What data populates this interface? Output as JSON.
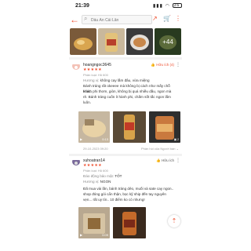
{
  "status": {
    "time": "21:39",
    "battery": "36"
  },
  "topbar": {
    "search_placeholder": "Dầu Ăn Cái Lân"
  },
  "gallery": {
    "more_count": "+44"
  },
  "reviews": [
    {
      "username": "hoangngoc3645",
      "helpful": "Hữu ích (4)",
      "stars": "★★★★★",
      "variant": "Phân loại: Hũ 600",
      "taste_label": "Hương vị:",
      "taste_value": "không cay lắm đâu, vừa miệng",
      "body": [
        "Bánh tráng rất okeeee mà không bị cách như mấy chỗ khác.",
        "Hành phi thơm, giòn, không bị quá nhiều dầu, ngon mà",
        "rẻ. Bánh tráng cuốn ít hành phi, chấm sốt tắc ngon lắm",
        "luôn."
      ],
      "video_time": "0:13",
      "date": "29-10-2023 09:20",
      "report": "Phản hồi của Người bán"
    },
    {
      "username": "xuhoatran14",
      "helpful": "Hữu ích",
      "stars": "★★★★★",
      "variant": "Phân loại: Hũ 600",
      "quality_label": "Đáo động bảo mật:",
      "quality_value": "TỐT",
      "taste_label": "Hương vị:",
      "taste_value": "NGON",
      "body": [
        "Đã mua vài lần, bánh tráng dẻo, muối và sate cay ngon..",
        "shop đóng gói cẩn thận, bọc kỹ ship đến tay nguyên",
        "vẹn... rất uy tín.. 10 điểm ko có nhưng!"
      ],
      "video_time": "0:09"
    }
  ],
  "colors": {
    "accent": "#ee4d2d"
  }
}
